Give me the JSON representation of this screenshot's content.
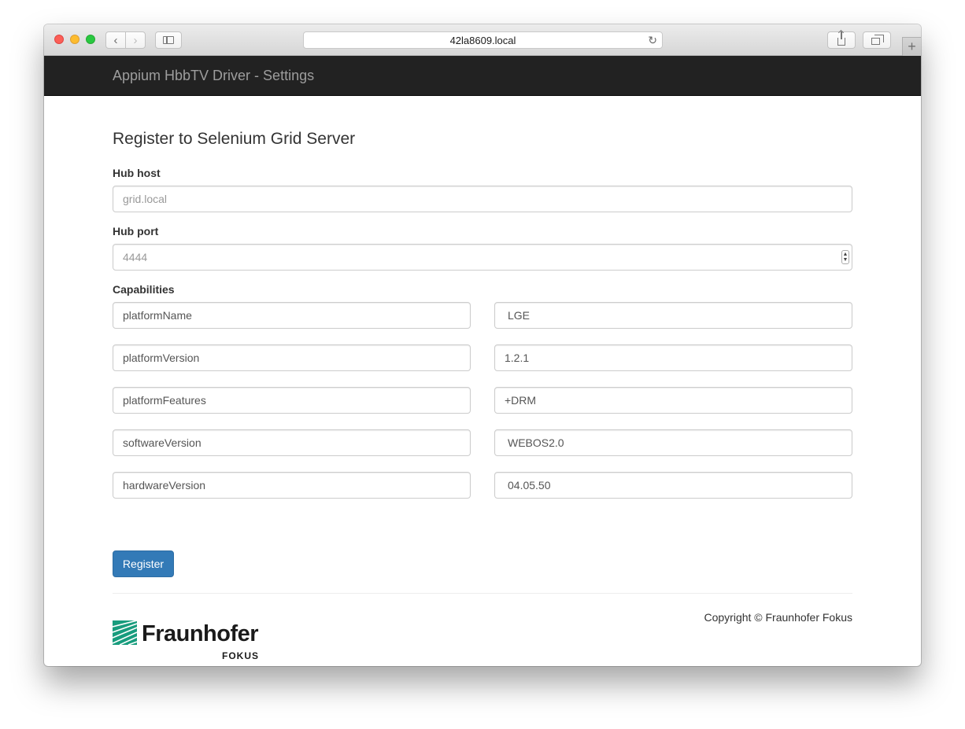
{
  "browser": {
    "url": "42la8609.local",
    "newtab_label": "+"
  },
  "navbar": {
    "brand": "Appium HbbTV Driver - Settings"
  },
  "main": {
    "title": "Register to Selenium Grid Server",
    "hub_host": {
      "label": "Hub host",
      "placeholder": "grid.local"
    },
    "hub_port": {
      "label": "Hub port",
      "placeholder": "4444"
    },
    "capabilities": {
      "label": "Capabilities",
      "rows": [
        {
          "key": "platformName",
          "value": "LGE"
        },
        {
          "key": "platformVersion",
          "value": "1.2.1"
        },
        {
          "key": "platformFeatures",
          "value": "+DRM"
        },
        {
          "key": "softwareVersion",
          "value": "WEBOS2.0"
        },
        {
          "key": "hardwareVersion",
          "value": "04.05.50"
        }
      ]
    },
    "register_label": "Register"
  },
  "footer": {
    "copyright": "Copyright © Fraunhofer Fokus",
    "logo_word": "Fraunhofer",
    "logo_sub": "FOKUS"
  },
  "colors": {
    "navbar_bg": "#222222",
    "brand_text": "#9d9d9d",
    "primary": "#337ab7",
    "logo_green": "#179c7d"
  },
  "icons": {
    "back": "chevron-left-icon",
    "forward": "chevron-right-icon",
    "sidebar": "sidebar-icon",
    "reload": "reload-icon",
    "share": "share-icon",
    "tabs": "tabs-icon"
  }
}
